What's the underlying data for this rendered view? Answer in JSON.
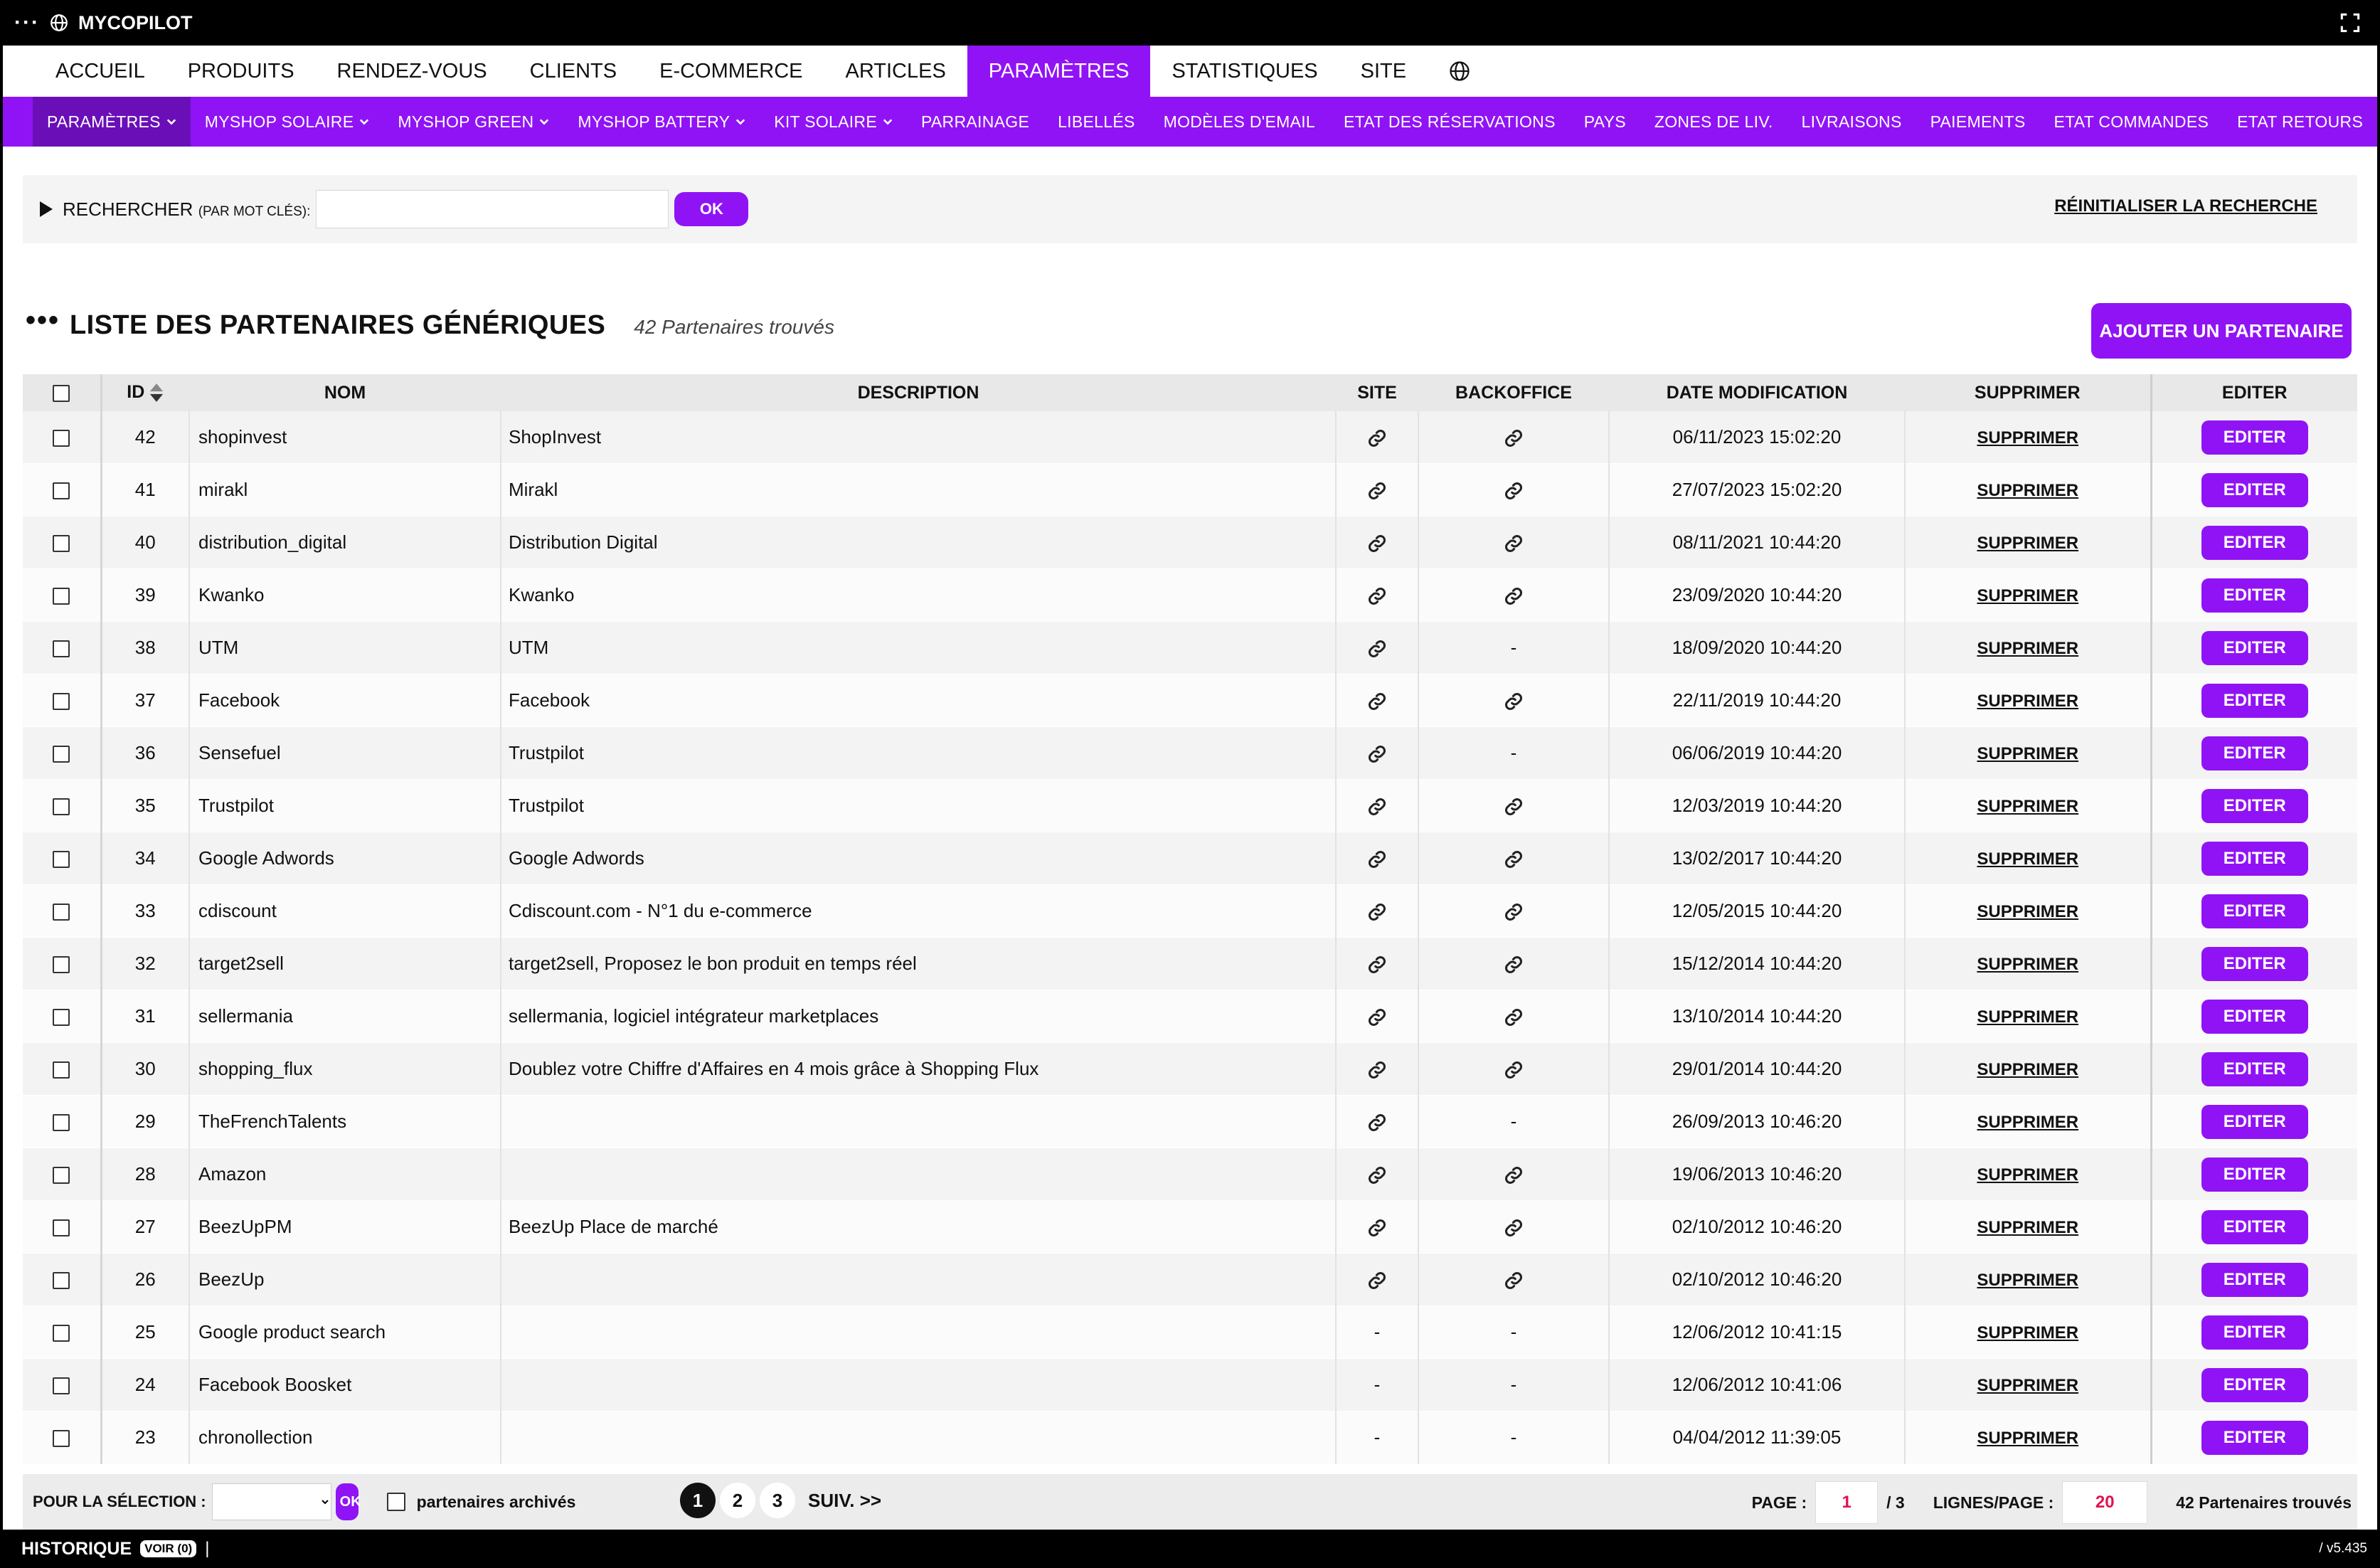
{
  "app": {
    "title": "MYCOPILOT"
  },
  "main_nav": [
    {
      "label": "ACCUEIL",
      "active": false
    },
    {
      "label": "PRODUITS",
      "active": false
    },
    {
      "label": "RENDEZ-VOUS",
      "active": false
    },
    {
      "label": "CLIENTS",
      "active": false
    },
    {
      "label": "E-COMMERCE",
      "active": false
    },
    {
      "label": "ARTICLES",
      "active": false
    },
    {
      "label": "PARAMÈTRES",
      "active": true
    },
    {
      "label": "STATISTIQUES",
      "active": false
    },
    {
      "label": "SITE",
      "active": false
    }
  ],
  "sub_nav": [
    {
      "label": "PARAMÈTRES",
      "dropdown": true,
      "active": true
    },
    {
      "label": "MYSHOP SOLAIRE",
      "dropdown": true
    },
    {
      "label": "MYSHOP GREEN",
      "dropdown": true
    },
    {
      "label": "MYSHOP BATTERY",
      "dropdown": true
    },
    {
      "label": "KIT SOLAIRE",
      "dropdown": true
    },
    {
      "label": "PARRAINAGE",
      "dropdown": false
    },
    {
      "label": "LIBELLÉS",
      "dropdown": false
    },
    {
      "label": "MODÈLES D'EMAIL",
      "dropdown": false
    },
    {
      "label": "ETAT DES RÉSERVATIONS",
      "dropdown": false
    },
    {
      "label": "PAYS",
      "dropdown": false
    },
    {
      "label": "ZONES DE LIV.",
      "dropdown": false
    },
    {
      "label": "LIVRAISONS",
      "dropdown": false
    },
    {
      "label": "PAIEMENTS",
      "dropdown": false
    },
    {
      "label": "ETAT COMMANDES",
      "dropdown": false
    },
    {
      "label": "ETAT RETOURS",
      "dropdown": false
    }
  ],
  "search": {
    "label": "RECHERCHER",
    "sublabel": "(PAR MOT CLÉS):",
    "value": "",
    "ok_label": "OK",
    "reset_label": "RÉINITIALISER LA RECHERCHE"
  },
  "list": {
    "title": "LISTE DES PARTENAIRES GÉNÉRIQUES",
    "count_text": "42 Partenaires trouvés",
    "add_label": "AJOUTER UN PARTENAIRE"
  },
  "table": {
    "headers": {
      "id": "ID",
      "nom": "NOM",
      "description": "DESCRIPTION",
      "site": "SITE",
      "backoffice": "BACKOFFICE",
      "date": "DATE MODIFICATION",
      "supprimer": "SUPPRIMER",
      "editer": "EDITER"
    },
    "delete_label": "SUPPRIMER",
    "edit_label": "EDITER",
    "empty_mark": "-",
    "rows": [
      {
        "id": "42",
        "nom": "shopinvest",
        "description": "ShopInvest",
        "site": true,
        "backoffice": true,
        "date": "06/11/2023 15:02:20"
      },
      {
        "id": "41",
        "nom": "mirakl",
        "description": "Mirakl",
        "site": true,
        "backoffice": true,
        "date": "27/07/2023 15:02:20"
      },
      {
        "id": "40",
        "nom": "distribution_digital",
        "description": "Distribution Digital",
        "site": true,
        "backoffice": true,
        "date": "08/11/2021 10:44:20"
      },
      {
        "id": "39",
        "nom": "Kwanko",
        "description": "Kwanko",
        "site": true,
        "backoffice": true,
        "date": "23/09/2020 10:44:20"
      },
      {
        "id": "38",
        "nom": "UTM",
        "description": "UTM",
        "site": true,
        "backoffice": false,
        "date": "18/09/2020 10:44:20"
      },
      {
        "id": "37",
        "nom": "Facebook",
        "description": "Facebook",
        "site": true,
        "backoffice": true,
        "date": "22/11/2019 10:44:20"
      },
      {
        "id": "36",
        "nom": "Sensefuel",
        "description": "Trustpilot",
        "site": true,
        "backoffice": false,
        "date": "06/06/2019 10:44:20"
      },
      {
        "id": "35",
        "nom": "Trustpilot",
        "description": "Trustpilot",
        "site": true,
        "backoffice": true,
        "date": "12/03/2019 10:44:20"
      },
      {
        "id": "34",
        "nom": "Google Adwords",
        "description": "Google Adwords",
        "site": true,
        "backoffice": true,
        "date": "13/02/2017 10:44:20"
      },
      {
        "id": "33",
        "nom": "cdiscount",
        "description": "Cdiscount.com - N°1 du e-commerce",
        "site": true,
        "backoffice": true,
        "date": "12/05/2015 10:44:20"
      },
      {
        "id": "32",
        "nom": "target2sell",
        "description": "target2sell, Proposez le bon produit en temps réel",
        "site": true,
        "backoffice": true,
        "date": "15/12/2014 10:44:20"
      },
      {
        "id": "31",
        "nom": "sellermania",
        "description": "sellermania, logiciel intégrateur marketplaces",
        "site": true,
        "backoffice": true,
        "date": "13/10/2014 10:44:20"
      },
      {
        "id": "30",
        "nom": "shopping_flux",
        "description": "Doublez votre Chiffre d'Affaires en 4 mois grâce à Shopping Flux",
        "site": true,
        "backoffice": true,
        "date": "29/01/2014 10:44:20"
      },
      {
        "id": "29",
        "nom": "TheFrenchTalents",
        "description": "",
        "site": true,
        "backoffice": false,
        "date": "26/09/2013 10:46:20"
      },
      {
        "id": "28",
        "nom": "Amazon",
        "description": "",
        "site": true,
        "backoffice": true,
        "date": "19/06/2013 10:46:20"
      },
      {
        "id": "27",
        "nom": "BeezUpPM",
        "description": "BeezUp Place de marché",
        "site": true,
        "backoffice": true,
        "date": "02/10/2012 10:46:20"
      },
      {
        "id": "26",
        "nom": "BeezUp",
        "description": "",
        "site": true,
        "backoffice": true,
        "date": "02/10/2012 10:46:20"
      },
      {
        "id": "25",
        "nom": "Google product search",
        "description": "",
        "site": false,
        "backoffice": false,
        "date": "12/06/2012 10:41:15"
      },
      {
        "id": "24",
        "nom": "Facebook Boosket",
        "description": "",
        "site": false,
        "backoffice": false,
        "date": "12/06/2012 10:41:06"
      },
      {
        "id": "23",
        "nom": "chronollection",
        "description": "",
        "site": false,
        "backoffice": false,
        "date": "04/04/2012 11:39:05"
      }
    ]
  },
  "footer": {
    "selection_label": "POUR LA SÉLECTION :",
    "ok_label": "OK",
    "archived_label": "partenaires archivés",
    "pages": [
      "1",
      "2",
      "3"
    ],
    "current_page": "1",
    "next_label": "SUIV. >>",
    "page_label": "PAGE :",
    "page_total": "/ 3",
    "lines_label": "LIGNES/PAGE :",
    "lines_value": "20",
    "count_text": "42 Partenaires trouvés"
  },
  "bottom": {
    "history_label": "HISTORIQUE",
    "voir_label": "VOIR (0)",
    "separator": "|",
    "version": "/ v5.435"
  },
  "colors": {
    "accent": "#9013f5",
    "accent_dark": "#6a0fb8",
    "page_input_text": "#e2134f"
  }
}
